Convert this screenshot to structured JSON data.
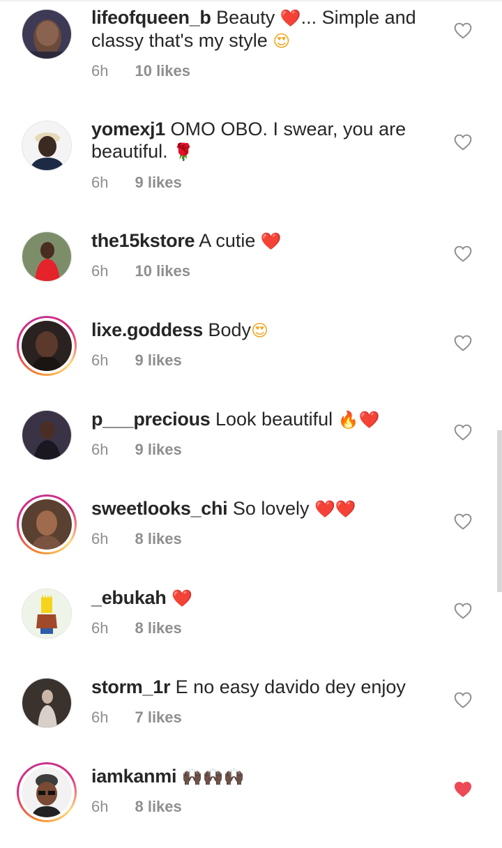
{
  "comments": [
    {
      "username": "lifeofqueen_b",
      "text": "Beauty",
      "emoji_after": "❤️",
      "text2": "... Simple and classy that's my style",
      "emoji_end": "😍",
      "time": "6h",
      "likes": "10 likes",
      "story": false,
      "liked": false
    },
    {
      "username": "yomexj1",
      "text": "OMO OBO. I swear, you are beautiful.",
      "emoji_end": "🌹",
      "time": "6h",
      "likes": "9 likes",
      "story": false,
      "liked": false
    },
    {
      "username": "the15kstore",
      "text": "A cutie",
      "emoji_end": "❤️",
      "time": "6h",
      "likes": "10 likes",
      "story": false,
      "liked": false
    },
    {
      "username": "lixe.goddess",
      "text": "Body",
      "emoji_end": "😍",
      "time": "6h",
      "likes": "9 likes",
      "story": true,
      "liked": false
    },
    {
      "username": "p___precious",
      "text": "Look beautiful",
      "emoji_end": "🔥❤️",
      "time": "6h",
      "likes": "9 likes",
      "story": false,
      "liked": false
    },
    {
      "username": "sweetlooks_chi",
      "text": "So lovely",
      "emoji_end": "❤️❤️",
      "time": "6h",
      "likes": "8 likes",
      "story": true,
      "liked": false
    },
    {
      "username": "_ebukah",
      "text": "",
      "emoji_end": "❤️",
      "time": "6h",
      "likes": "8 likes",
      "story": false,
      "liked": false
    },
    {
      "username": "storm_1r",
      "text": "E no easy davido dey enjoy",
      "emoji_end": "",
      "time": "6h",
      "likes": "7 likes",
      "story": false,
      "liked": false
    },
    {
      "username": "iamkanmi",
      "text": "",
      "emoji_end": "🙌🏿🙌🏿🙌🏿",
      "time": "6h",
      "likes": "8 likes",
      "story": true,
      "liked": true
    }
  ],
  "colors": {
    "like_red": "#ed4956",
    "meta_gray": "#8e8e8e",
    "text": "#262626"
  },
  "icons": {
    "heart_outline": "heart-outline-icon",
    "heart_filled": "heart-filled-icon"
  }
}
